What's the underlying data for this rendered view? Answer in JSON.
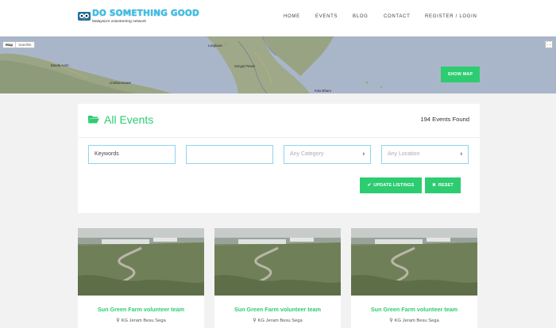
{
  "header": {
    "logo_title": "DO SOMETHING GOOD",
    "logo_tagline": "Malaysia's volunteering network",
    "nav": [
      "HOME",
      "EVENTS",
      "BLOG",
      "CONTACT",
      "REGISTER / LOGIN"
    ]
  },
  "map": {
    "toggle_map": "Map",
    "toggle_satellite": "Satellite",
    "places": [
      "Langkawi",
      "Banda Aceh",
      "Lhokseumawe",
      "Sungai Petani",
      "Kota Bharu"
    ],
    "show_map_label": "SHOW MAP"
  },
  "panel": {
    "title": "All Events",
    "count_text": "194 Events Found",
    "keywords_value": "Keywords",
    "location_text_value": "",
    "category_placeholder": "Any Category",
    "location_placeholder": "Any Location",
    "update_label": "UPDATE LISTINGS",
    "reset_label": "RESET"
  },
  "events": [
    {
      "title": "Sun Green Farm volunteer team",
      "location": "KG Jeram Besu Sega"
    },
    {
      "title": "Sun Green Farm volunteer team",
      "location": "KG Jeram Besu Sega"
    },
    {
      "title": "Sun Green Farm volunteer team",
      "location": "KG Jeram Besu Sega"
    }
  ],
  "colors": {
    "accent": "#2ecc71",
    "logo_blue": "#38c2e8",
    "map_sea": "#a9b6ca",
    "page_bg": "#f2f2f2"
  },
  "icons": [
    "owl-logo-icon",
    "folder-open-icon",
    "check-icon",
    "close-icon",
    "map-pin-icon",
    "fullscreen-icon",
    "select-arrows-icon"
  ]
}
